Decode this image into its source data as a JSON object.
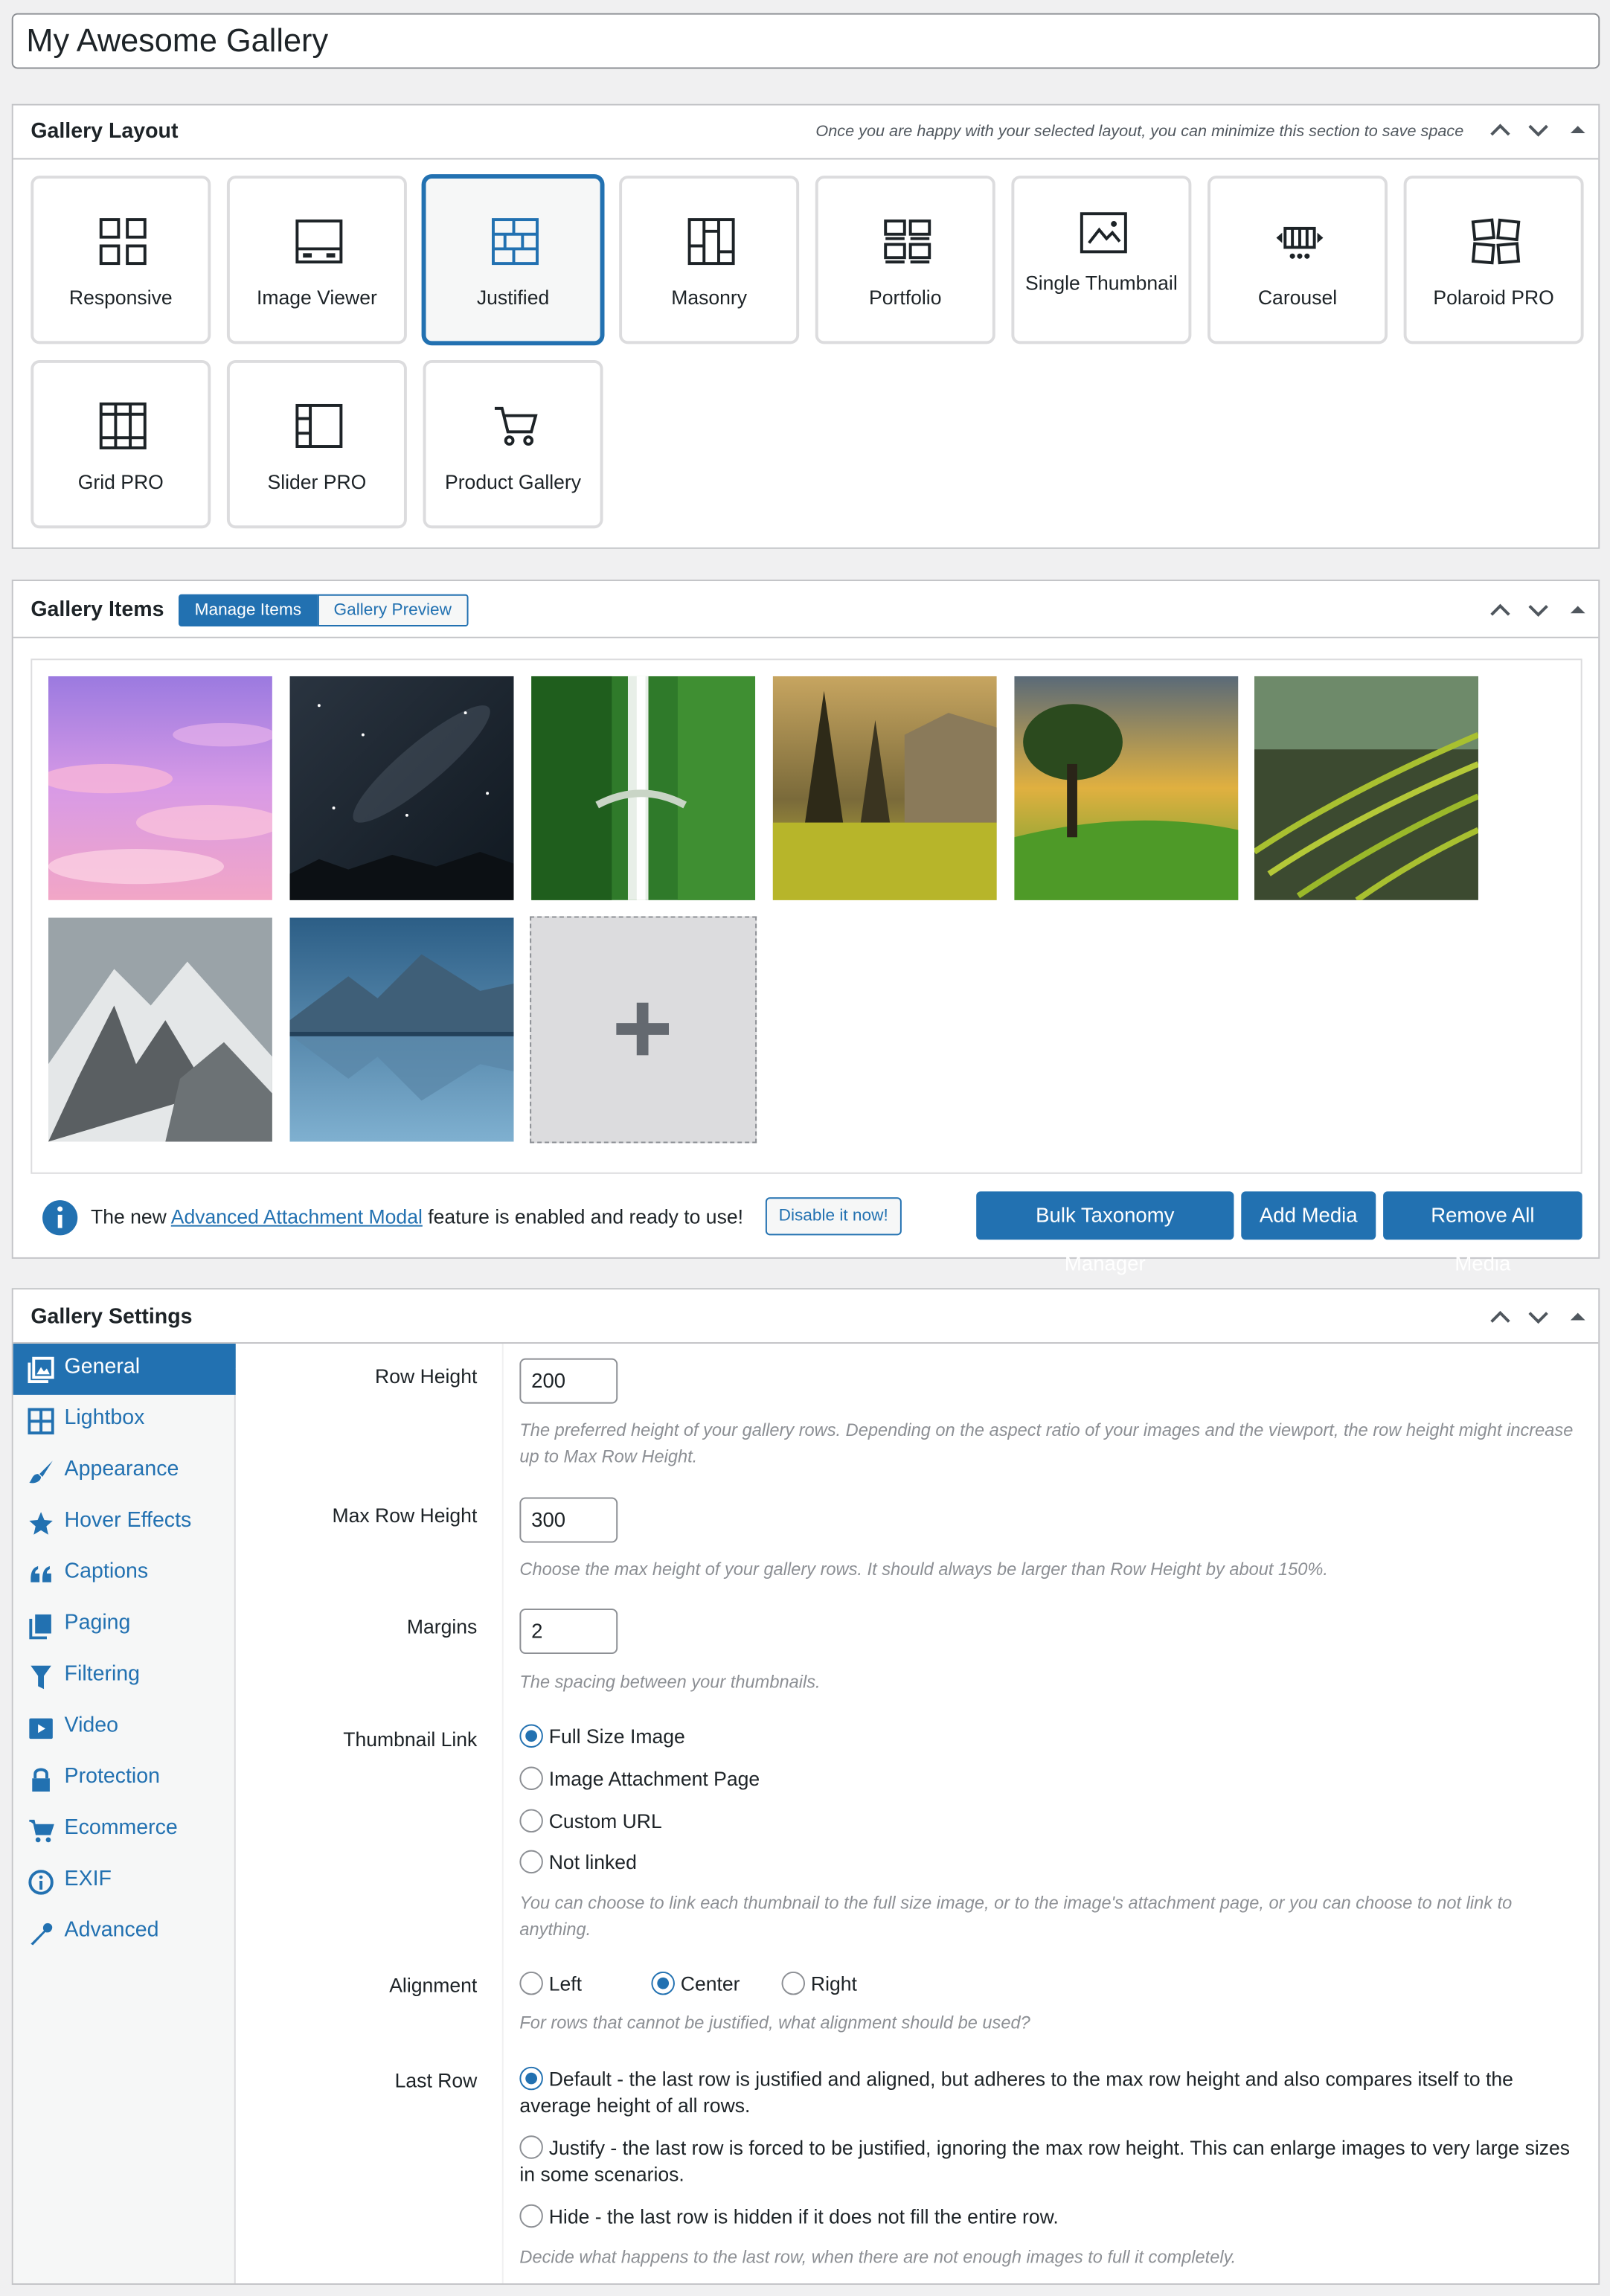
{
  "gallery_title": "My Awesome Gallery",
  "layout_box": {
    "title": "Gallery Layout",
    "note": "Once you are happy with your selected layout, you can minimize this section to save space",
    "selected": "Justified",
    "tiles": [
      {
        "label": "Responsive",
        "icon": "grid-2x2-icon"
      },
      {
        "label": "Image Viewer",
        "icon": "image-viewer-icon"
      },
      {
        "label": "Justified",
        "icon": "justified-icon"
      },
      {
        "label": "Masonry",
        "icon": "masonry-icon"
      },
      {
        "label": "Portfolio",
        "icon": "portfolio-icon"
      },
      {
        "label": "Single Thumbnail",
        "icon": "single-thumbnail-icon"
      },
      {
        "label": "Carousel",
        "icon": "carousel-icon"
      },
      {
        "label": "Polaroid PRO",
        "icon": "polaroid-icon"
      },
      {
        "label": "Grid PRO",
        "icon": "grid-pro-icon"
      },
      {
        "label": "Slider PRO",
        "icon": "slider-icon"
      },
      {
        "label": "Product Gallery",
        "icon": "cart-icon"
      }
    ]
  },
  "items_box": {
    "title": "Gallery Items",
    "tabs": [
      "Manage Items",
      "Gallery Preview"
    ],
    "active_tab": "Manage Items",
    "thumbnails": [
      "pink clouds sky",
      "night starry sky",
      "green waterfall",
      "sunlit forest meadow",
      "tree on green hill",
      "rice terraces",
      "snowy mountains",
      "mountain lake reflection"
    ],
    "notice": {
      "before": "The new ",
      "link": "Advanced Attachment Modal",
      "after": " feature is enabled and ready to use!",
      "button": "Disable it now!"
    },
    "buttons": [
      "Bulk Taxonomy Manager",
      "Add Media",
      "Remove All Media"
    ]
  },
  "settings_box": {
    "title": "Gallery Settings",
    "nav": [
      {
        "label": "General",
        "icon": "gallery-icon"
      },
      {
        "label": "Lightbox",
        "icon": "grid-icon"
      },
      {
        "label": "Appearance",
        "icon": "brush-icon"
      },
      {
        "label": "Hover Effects",
        "icon": "star-icon"
      },
      {
        "label": "Captions",
        "icon": "quote-icon"
      },
      {
        "label": "Paging",
        "icon": "pages-icon"
      },
      {
        "label": "Filtering",
        "icon": "filter-icon"
      },
      {
        "label": "Video",
        "icon": "video-icon"
      },
      {
        "label": "Protection",
        "icon": "lock-icon"
      },
      {
        "label": "Ecommerce",
        "icon": "cart-icon"
      },
      {
        "label": "EXIF",
        "icon": "info-icon"
      },
      {
        "label": "Advanced",
        "icon": "wrench-icon"
      }
    ],
    "active_nav": "General",
    "row_height": {
      "label": "Row Height",
      "value": "200",
      "help": "The preferred height of your gallery rows. Depending on the aspect ratio of your images and the viewport, the row height might increase up to Max Row Height."
    },
    "max_row_height": {
      "label": "Max Row Height",
      "value": "300",
      "help": "Choose the max height of your gallery rows. It should always be larger than Row Height by about 150%."
    },
    "margins": {
      "label": "Margins",
      "value": "2",
      "help": "The spacing between your thumbnails."
    },
    "thumbnail_link": {
      "label": "Thumbnail Link",
      "options": [
        "Full Size Image",
        "Image Attachment Page",
        "Custom URL",
        "Not linked"
      ],
      "selected": "Full Size Image",
      "help": "You can choose to link each thumbnail to the full size image, or to the image's attachment page, or you can choose to not link to anything."
    },
    "alignment": {
      "label": "Alignment",
      "options": [
        "Left",
        "Center",
        "Right"
      ],
      "selected": "Center",
      "help": "For rows that cannot be justified, what alignment should be used?"
    },
    "last_row": {
      "label": "Last Row",
      "options": [
        "Default - the last row is justified and aligned, but adheres to the max row height and also compares itself to the average height of all rows.",
        "Justify - the last row is forced to be justified, ignoring the max row height. This can enlarge images to very large sizes in some scenarios.",
        "Hide - the last row is hidden if it does not fill the entire row."
      ],
      "selected": 0,
      "help": "Decide what happens to the last row, when there are not enough images to full it completely."
    }
  },
  "colors": {
    "accent": "#2271b1",
    "border": "#c3c4c7",
    "background": "#f0f0f1"
  }
}
